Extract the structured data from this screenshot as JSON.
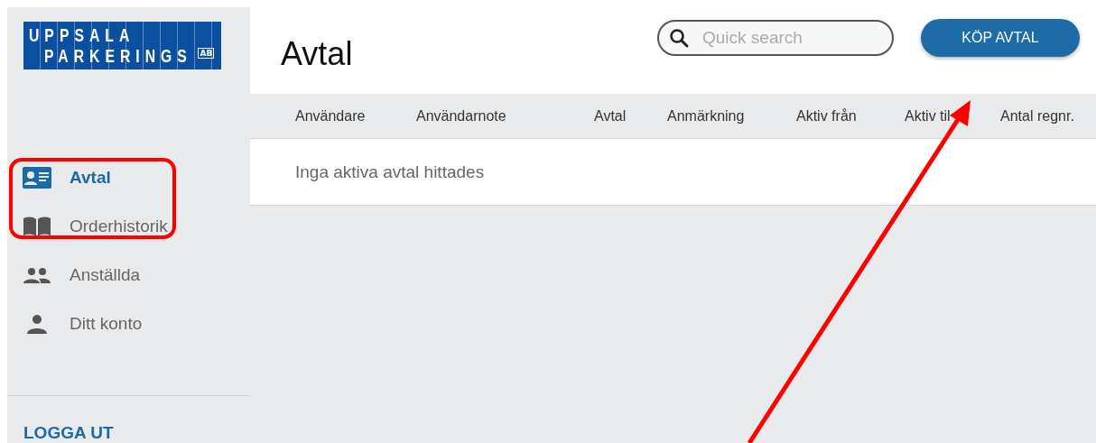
{
  "logo": {
    "line_1": "UPPSALA",
    "line_2": "PARKERINGS",
    "suffix": "AB"
  },
  "sidebar": {
    "items": [
      {
        "label": "Avtal",
        "selected": true
      },
      {
        "label": "Orderhistorik",
        "selected": false
      },
      {
        "label": "Anställda",
        "selected": false
      },
      {
        "label": "Ditt konto",
        "selected": false
      }
    ],
    "logout": "LOGGA UT"
  },
  "page": {
    "title": "Avtal",
    "search": {
      "placeholder": "Quick search"
    },
    "buy_button": "KÖP AVTAL"
  },
  "table": {
    "columns": [
      "Användare",
      "Användarnote",
      "Avtal",
      "Anmärkning",
      "Aktiv från",
      "Aktiv til",
      "Antal regnr."
    ],
    "empty_message": "Inga aktiva avtal hittades"
  }
}
